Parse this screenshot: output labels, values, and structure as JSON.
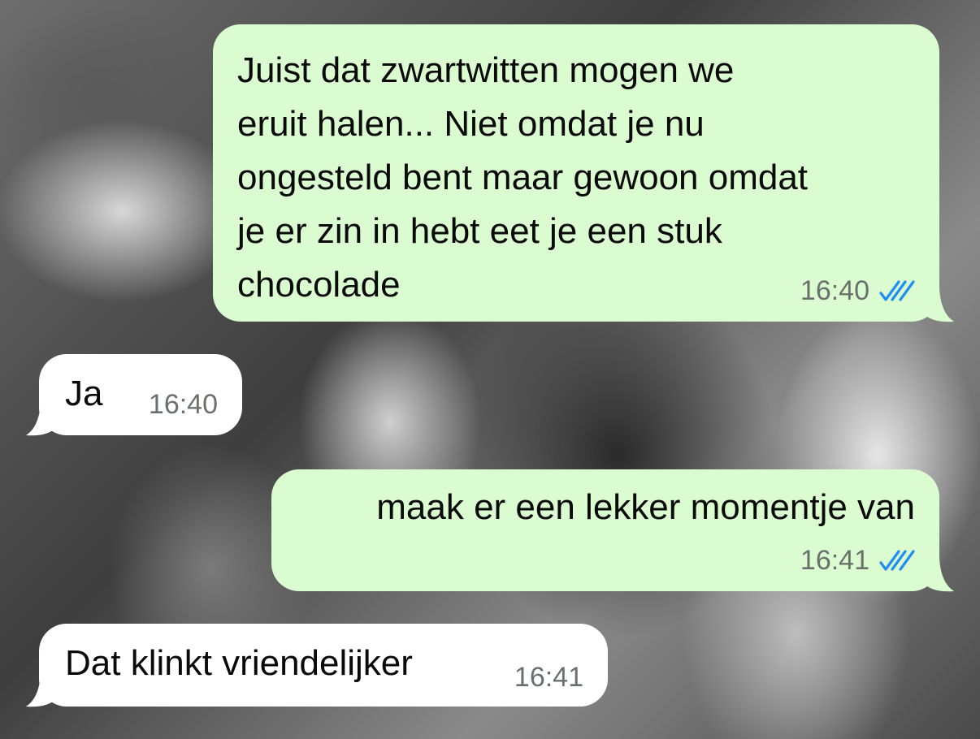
{
  "messages": [
    {
      "direction": "outgoing",
      "text": "Juist dat zwartwitten mogen we\neruit halen... Niet omdat je nu\nongesteld bent maar gewoon omdat\nje er zin in hebt eet je een stuk\nchocolade",
      "time": "16:40",
      "status": "read-double-check"
    },
    {
      "direction": "incoming",
      "text": "Ja",
      "time": "16:40"
    },
    {
      "direction": "outgoing",
      "text": "maak er een lekker momentje van",
      "time": "16:41",
      "status": "read-double-check"
    },
    {
      "direction": "incoming",
      "text": "Dat klinkt vriendelijker",
      "time": "16:41"
    }
  ],
  "colors": {
    "outgoing_bubble": "#dafcd0",
    "incoming_bubble": "#ffffff",
    "read_ticks": "#1f8ef1",
    "timestamp": "#6c706c"
  }
}
